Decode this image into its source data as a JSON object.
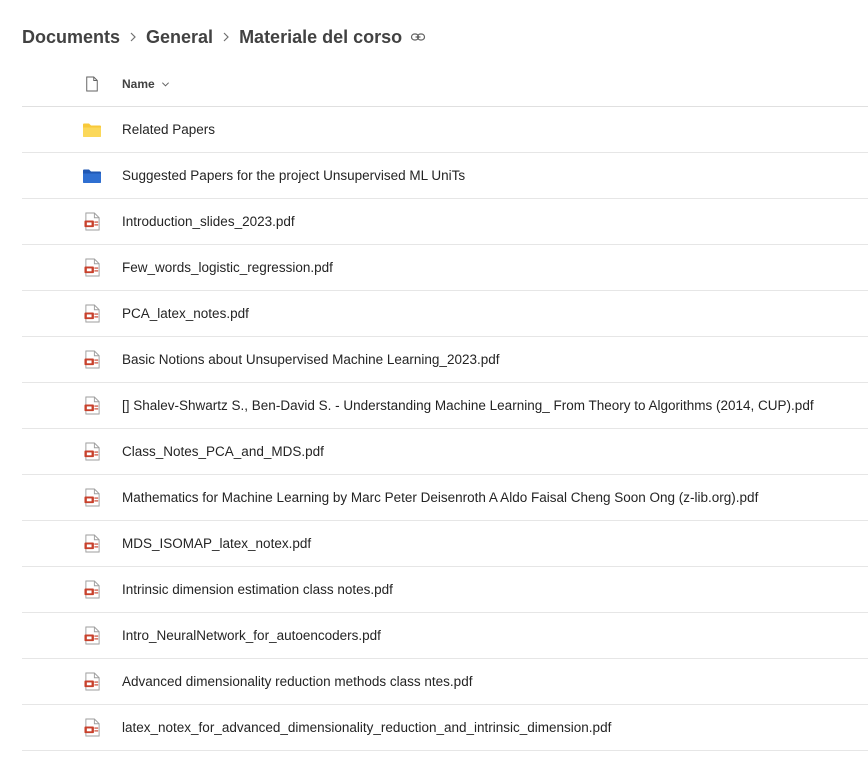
{
  "breadcrumb": {
    "items": [
      {
        "label": "Documents"
      },
      {
        "label": "General"
      },
      {
        "label": "Materiale del corso"
      }
    ],
    "link_icon": "link-icon"
  },
  "list": {
    "header": {
      "file_type_icon": "document-icon",
      "name_label": "Name",
      "sort_icon": "chevron-down-icon"
    },
    "rows": [
      {
        "name": "Related Papers",
        "icon": "folder-yellow-icon"
      },
      {
        "name": "Suggested Papers for the project Unsupervised ML UniTs",
        "icon": "folder-blue-icon"
      },
      {
        "name": "Introduction_slides_2023.pdf",
        "icon": "pdf-icon"
      },
      {
        "name": "Few_words_logistic_regression.pdf",
        "icon": "pdf-icon"
      },
      {
        "name": "PCA_latex_notes.pdf",
        "icon": "pdf-icon"
      },
      {
        "name": "Basic Notions about Unsupervised Machine Learning_2023.pdf",
        "icon": "pdf-icon"
      },
      {
        "name": "[] Shalev-Shwartz S., Ben-David S. - Understanding Machine Learning_ From Theory to Algorithms (2014, CUP).pdf",
        "icon": "pdf-icon"
      },
      {
        "name": "Class_Notes_PCA_and_MDS.pdf",
        "icon": "pdf-icon"
      },
      {
        "name": "Mathematics for Machine Learning by Marc Peter Deisenroth A Aldo Faisal Cheng Soon Ong (z-lib.org).pdf",
        "icon": "pdf-icon"
      },
      {
        "name": "MDS_ISOMAP_latex_notex.pdf",
        "icon": "pdf-icon"
      },
      {
        "name": "Intrinsic dimension estimation class notes.pdf",
        "icon": "pdf-icon"
      },
      {
        "name": "Intro_NeuralNetwork_for_autoencoders.pdf",
        "icon": "pdf-icon"
      },
      {
        "name": "Advanced dimensionality reduction methods class ntes.pdf",
        "icon": "pdf-icon"
      },
      {
        "name": "latex_notex_for_advanced_dimensionality_reduction_and_intrinsic_dimension.pdf",
        "icon": "pdf-icon"
      }
    ]
  },
  "colors": {
    "folder_yellow": "#f8c93a",
    "folder_blue": "#2f6fd1",
    "pdf_red": "#c8412c",
    "divider": "#e6e6e6"
  }
}
